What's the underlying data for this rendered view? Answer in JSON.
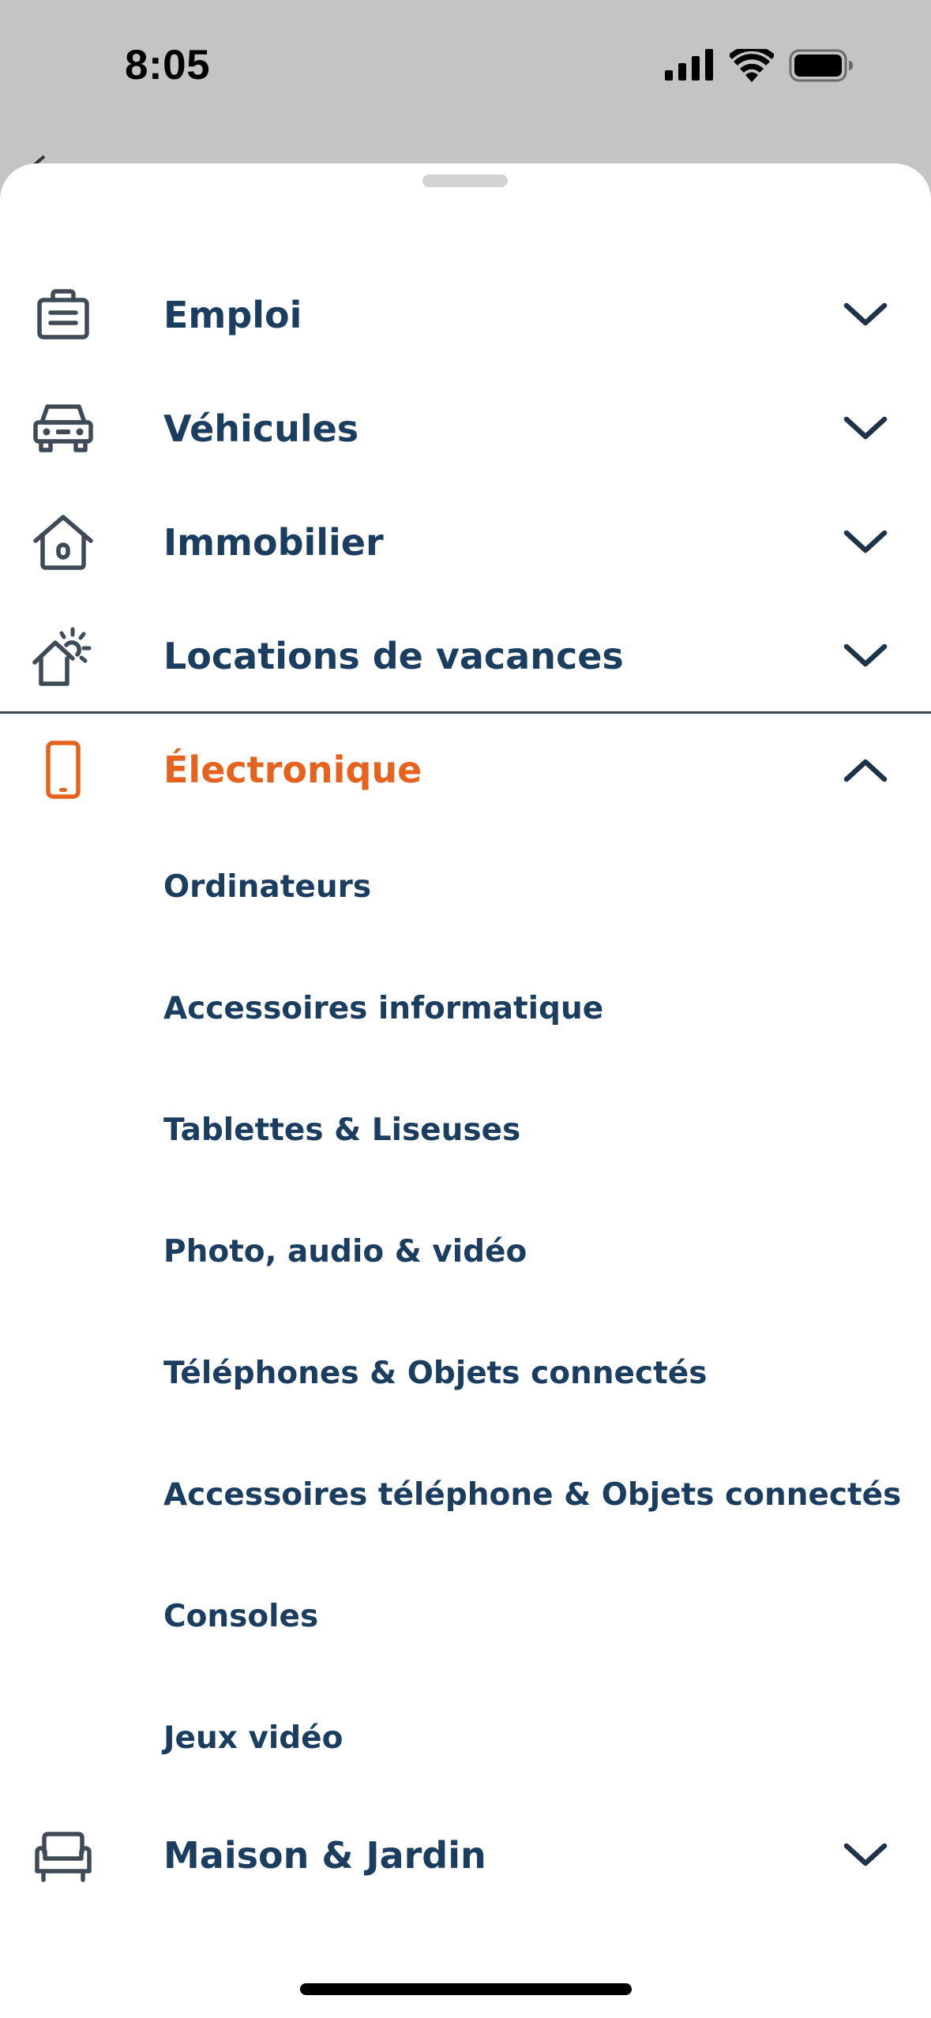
{
  "status_bar": {
    "time": "8:05",
    "icons": [
      "cellular-signal-icon",
      "wifi-icon",
      "battery-icon"
    ]
  },
  "colors": {
    "text_primary": "#1a3d60",
    "accent": "#e5631e",
    "icon": "#3e4a55"
  },
  "categories": [
    {
      "label": "Emploi",
      "icon": "briefcase-icon",
      "expanded": false
    },
    {
      "label": "Véhicules",
      "icon": "car-icon",
      "expanded": false
    },
    {
      "label": "Immobilier",
      "icon": "house-icon",
      "expanded": false
    },
    {
      "label": "Locations de vacances",
      "icon": "vacation-house-sun-icon",
      "expanded": false
    },
    {
      "label": "Électronique",
      "icon": "smartphone-icon",
      "expanded": true,
      "subcategories": [
        "Ordinateurs",
        "Accessoires informatique",
        "Tablettes & Liseuses",
        "Photo, audio & vidéo",
        "Téléphones & Objets connectés",
        "Accessoires téléphone & Objets connectés",
        "Consoles",
        "Jeux vidéo"
      ]
    },
    {
      "label": "Maison & Jardin",
      "icon": "armchair-icon",
      "expanded": false
    }
  ]
}
